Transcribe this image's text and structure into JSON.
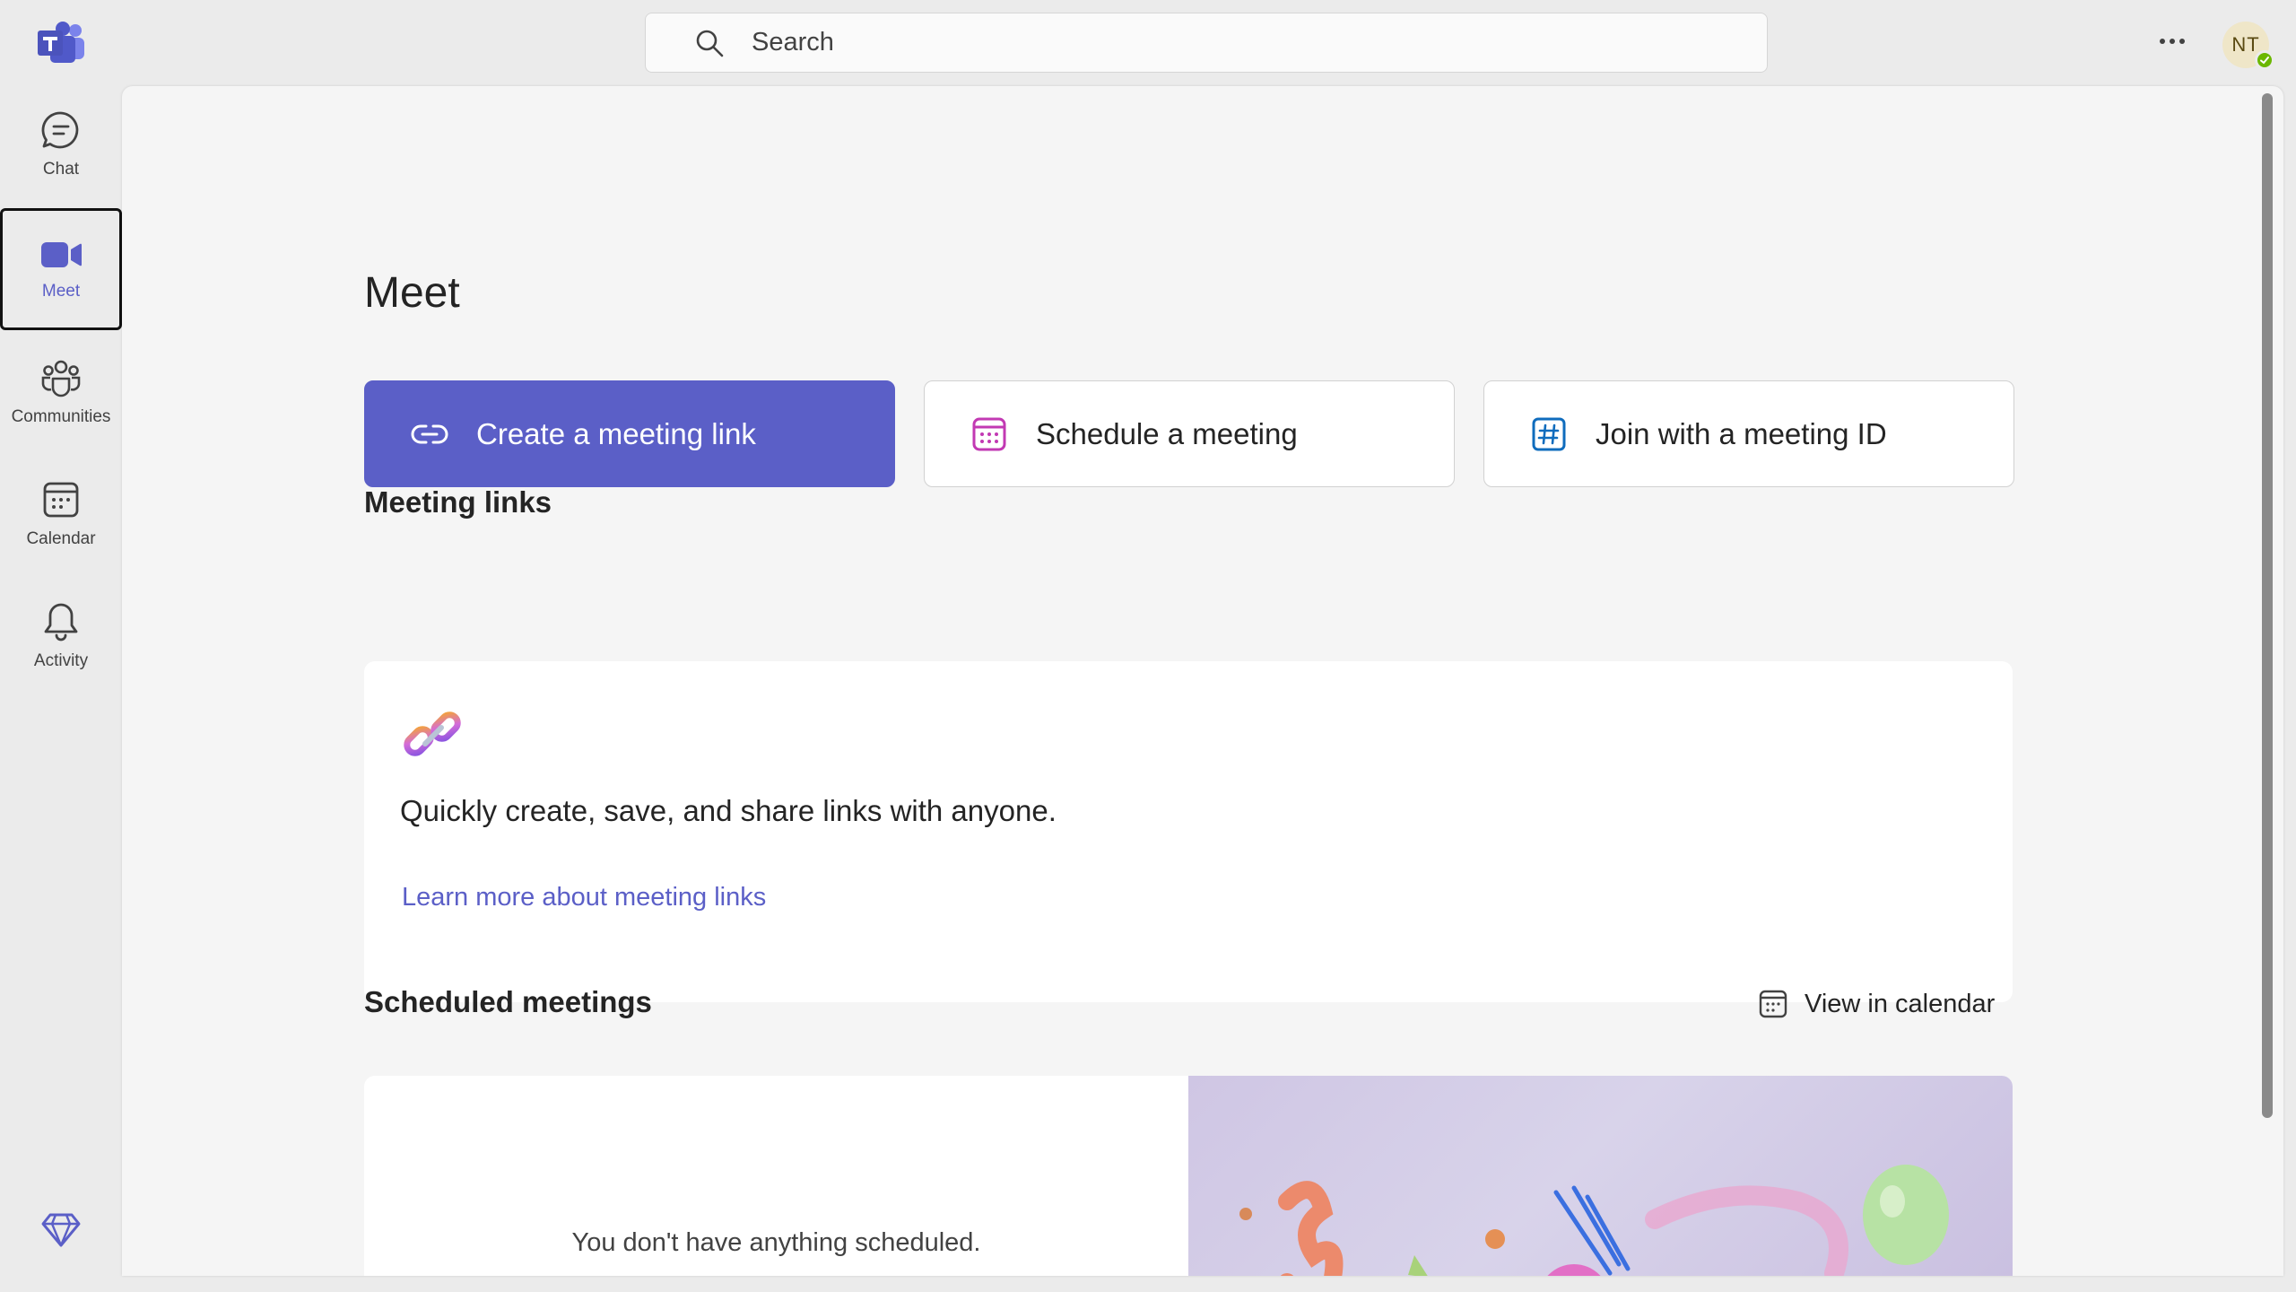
{
  "app": {
    "name": "Microsoft Teams"
  },
  "header": {
    "search_placeholder": "Search",
    "more_label": "···",
    "user_initials": "NT",
    "presence": "available"
  },
  "rail": {
    "items": [
      {
        "label": "Chat",
        "icon": "chat-icon",
        "active": false
      },
      {
        "label": "Meet",
        "icon": "video-camera-icon",
        "active": true
      },
      {
        "label": "Communities",
        "icon": "people-community-icon",
        "active": false
      },
      {
        "label": "Calendar",
        "icon": "calendar-icon",
        "active": false
      },
      {
        "label": "Activity",
        "icon": "bell-icon",
        "active": false
      }
    ],
    "bottom_icon": "premium-diamond-icon"
  },
  "main": {
    "title": "Meet",
    "actions": {
      "create_link": "Create a meeting link",
      "schedule": "Schedule a meeting",
      "join": "Join with a meeting ID"
    },
    "meeting_links": {
      "heading": "Meeting links",
      "description": "Quickly create, save, and share links with anyone.",
      "learn_more": "Learn more about meeting links"
    },
    "scheduled": {
      "heading": "Scheduled meetings",
      "view_in_calendar": "View in calendar",
      "empty_text": "You don't have anything scheduled."
    }
  },
  "colors": {
    "accent": "#5b5fc7",
    "background": "#ebebeb",
    "panel": "#f5f5f5",
    "card": "#ffffff",
    "schedule_icon": "#c239b3",
    "join_icon": "#0f6cbd",
    "presence": "#6bb700"
  }
}
